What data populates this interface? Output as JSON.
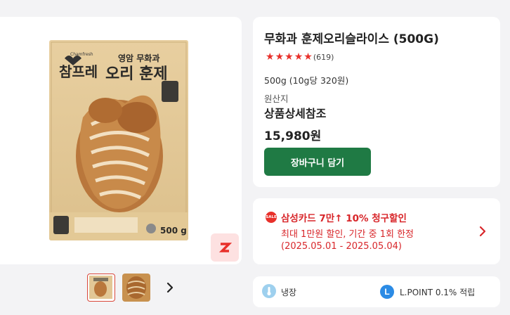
{
  "product": {
    "title": "무화과 훈제오리슬라이스 (500G)",
    "rating_stars": 5,
    "review_count": "(619)",
    "unit_price": "500g (10g당 320원)",
    "origin_label": "원산지",
    "origin_value": "상품상세참조",
    "price": "15,980원",
    "cart_button_label": "장바구니 담기"
  },
  "package": {
    "brand": "참프레",
    "brand_en": "Chamfresh",
    "subtitle": "영암 무화과",
    "name": "오리 훈제",
    "weight": "500 g"
  },
  "badges": {
    "zigzag": "Z",
    "sale": "SALE"
  },
  "promo": {
    "title": "삼성카드 7만↑ 10% 청구할인",
    "detail": "최대 1만원 할인, 기간 중 1회 한정",
    "period": "(2025.05.01 - 2025.05.04)"
  },
  "info": {
    "storage": "냉장",
    "lpoint_icon": "L",
    "lpoint": "L.POINT 0.1% 적립"
  },
  "colors": {
    "accent_green": "#1f7a44",
    "promo_red": "#d8262a",
    "star_red": "#e8302a",
    "zigzag_pink": "#fde1e1",
    "lpoint_blue": "#2b8be5"
  }
}
